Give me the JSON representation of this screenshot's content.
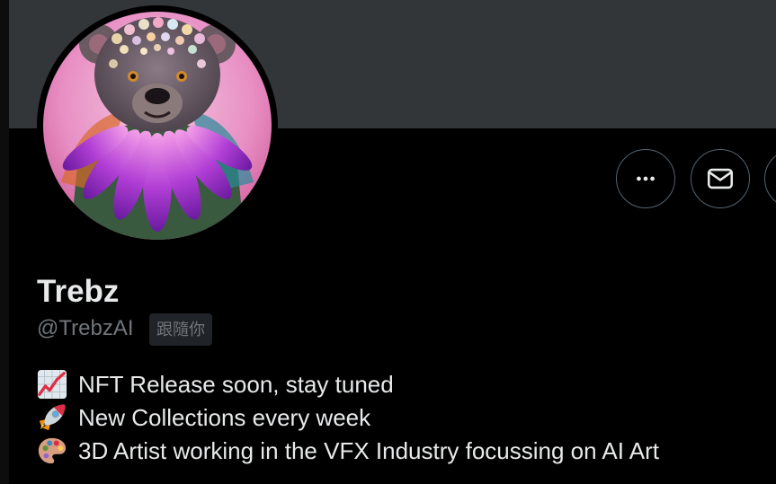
{
  "profile": {
    "display_name": "Trebz",
    "handle": "@TrebzAI",
    "follows_you_badge": "跟隨你"
  },
  "actions": {
    "more_icon": "more-horizontal-icon",
    "message_icon": "envelope-icon"
  },
  "bio": {
    "lines": [
      {
        "icon": "chart-increasing-icon",
        "text": "NFT Release soon, stay tuned"
      },
      {
        "icon": "rocket-icon",
        "text": "New Collections every week"
      },
      {
        "icon": "artist-palette-icon",
        "text": "3D Artist working in the VFX Industry focussing on AI Art"
      }
    ]
  },
  "colors": {
    "background": "#000000",
    "banner": "#333639",
    "text_primary": "#e7e9ea",
    "text_secondary": "#71767b",
    "button_border": "#536471",
    "badge_bg": "#202327"
  }
}
